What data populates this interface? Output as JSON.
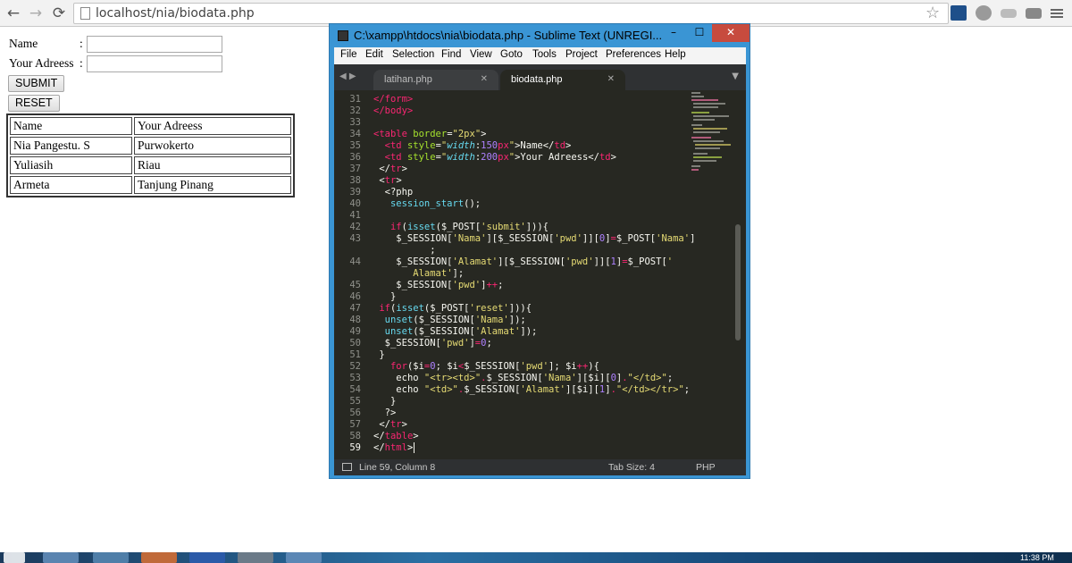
{
  "browser": {
    "back_icon": "←",
    "forward_icon": "→",
    "reload_icon": "⟳",
    "url": "localhost/nia/biodata.php",
    "star_icon": "☆"
  },
  "form": {
    "name_label": "Name",
    "address_label": "Your Adreess",
    "colon": ":",
    "submit_label": "SUBMIT",
    "reset_label": "RESET"
  },
  "table": {
    "headers": [
      "Name",
      "Your Adreess"
    ],
    "rows": [
      [
        "Nia Pangestu. S",
        "Purwokerto"
      ],
      [
        "Yuliasih",
        "Riau"
      ],
      [
        "Armeta",
        "Tanjung Pinang"
      ]
    ]
  },
  "editor_window": {
    "title": "C:\\xampp\\htdocs\\nia\\biodata.php - Sublime Text (UNREGI...",
    "minimize": "–",
    "maximize": "☐",
    "close": "✕",
    "menu": [
      "File",
      "Edit",
      "Selection",
      "Find",
      "View",
      "Goto",
      "Tools",
      "Project",
      "Preferences",
      "Help"
    ],
    "tab_arrows": "◀ ▶",
    "tabs": [
      {
        "label": "latihan.php",
        "close": "✕"
      },
      {
        "label": "biodata.php",
        "close": "✕"
      }
    ],
    "tab_dropdown": "▼",
    "line_numbers": [
      "31",
      "32",
      "33",
      "34",
      "35",
      "36",
      "37",
      "38",
      "39",
      "40",
      "41",
      "42",
      "43",
      "",
      "44",
      "",
      "45",
      "46",
      "47",
      "48",
      "49",
      "50",
      "51",
      "52",
      "53",
      "54",
      "55",
      "56",
      "57",
      "58",
      "59"
    ],
    "status": {
      "position": "Line 59, Column 8",
      "tab_size": "Tab Size: 4",
      "syntax": "PHP"
    }
  },
  "taskbar": {
    "clock": "11:38 PM"
  }
}
